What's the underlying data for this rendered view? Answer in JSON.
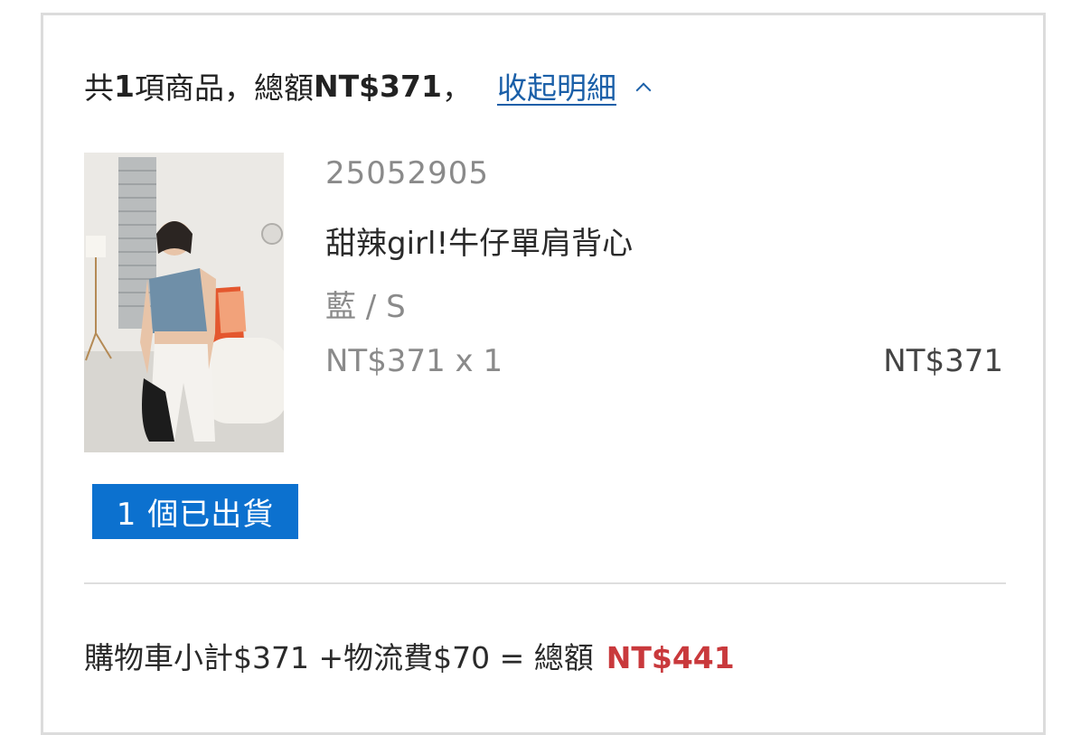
{
  "summary": {
    "prefix": "共",
    "count": "1",
    "items_word": "項商品，總額",
    "total": "NT$371",
    "comma": "，",
    "collapse_link": "收起明細"
  },
  "item": {
    "sku": "25052905",
    "name": "甜辣girl!牛仔單肩背心",
    "variant": "藍 / S",
    "unit_price_qty": "NT$371 x 1",
    "line_total": "NT$371"
  },
  "shipment_badge": "1 個已出貨",
  "totals": {
    "breakdown": "購物車小計$371 +物流費$70 = 總額",
    "grand_total": "NT$441"
  },
  "colors": {
    "link": "#1a5fa8",
    "badge_bg": "#0c71cf",
    "grand_total": "#c9393c"
  }
}
